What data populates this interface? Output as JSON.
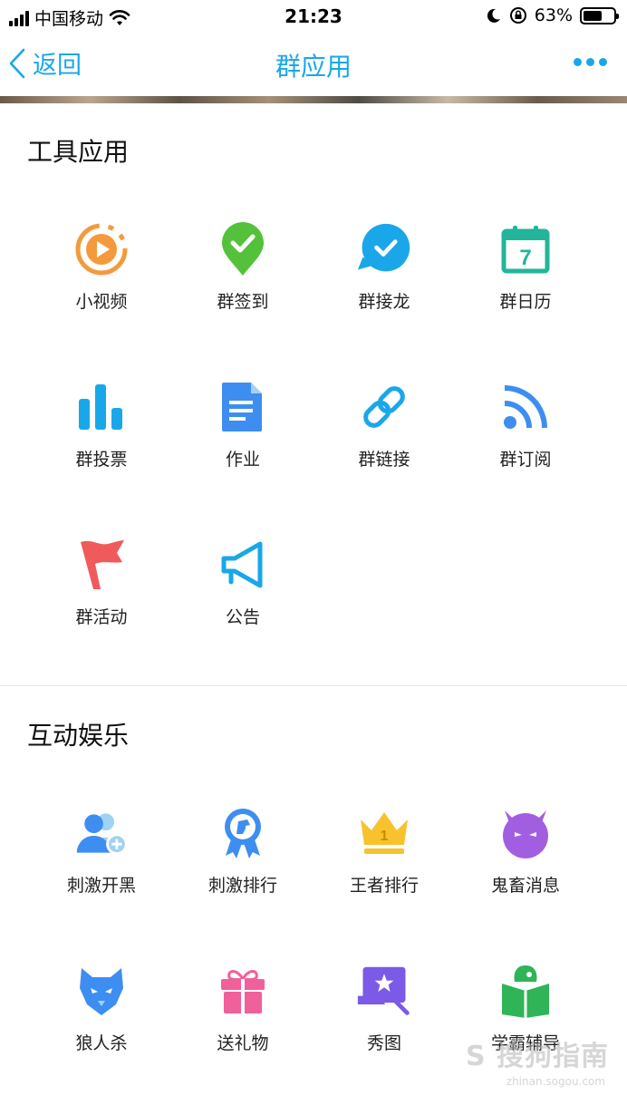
{
  "status_bar": {
    "carrier": "中国移动",
    "time": "21:23",
    "battery_pct": "63%",
    "battery_level": 0.63
  },
  "nav": {
    "back_label": "返回",
    "title": "群应用"
  },
  "sections": {
    "tools": {
      "title": "工具应用",
      "apps": [
        {
          "label": "小视频",
          "icon": "video-icon"
        },
        {
          "label": "群签到",
          "icon": "check-in-icon"
        },
        {
          "label": "群接龙",
          "icon": "chain-reply-icon"
        },
        {
          "label": "群日历",
          "icon": "calendar-icon"
        },
        {
          "label": "群投票",
          "icon": "vote-icon"
        },
        {
          "label": "作业",
          "icon": "homework-icon"
        },
        {
          "label": "群链接",
          "icon": "link-icon"
        },
        {
          "label": "群订阅",
          "icon": "rss-icon"
        },
        {
          "label": "群活动",
          "icon": "flag-icon"
        },
        {
          "label": "公告",
          "icon": "megaphone-icon"
        }
      ]
    },
    "fun": {
      "title": "互动娱乐",
      "apps": [
        {
          "label": "刺激开黑",
          "icon": "add-friend-icon"
        },
        {
          "label": "刺激排行",
          "icon": "ranking-badge-icon"
        },
        {
          "label": "王者排行",
          "icon": "crown-icon"
        },
        {
          "label": "鬼畜消息",
          "icon": "devil-icon"
        },
        {
          "label": "狼人杀",
          "icon": "wolf-icon"
        },
        {
          "label": "送礼物",
          "icon": "gift-icon"
        },
        {
          "label": "秀图",
          "icon": "magic-image-icon"
        },
        {
          "label": "学霸辅导",
          "icon": "study-book-icon"
        }
      ]
    }
  },
  "calendar_day": "7",
  "crown_number": "1",
  "watermark": "S 搜狗指南",
  "watermark_sub": "zhinan.sogou.com"
}
